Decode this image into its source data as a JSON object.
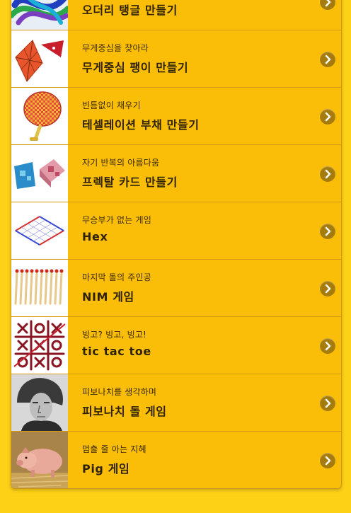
{
  "items": [
    {
      "subtitle": "",
      "title": "오더리 탱글 만들기",
      "thumb": "tangle-thumbnail"
    },
    {
      "subtitle": "무게중심을 찾아라",
      "title": "무게중심 팽이 만들기",
      "thumb": "kite-thumbnail"
    },
    {
      "subtitle": "빈틈없이 채우기",
      "title": "테셀레이션 부채 만들기",
      "thumb": "fan-thumbnail"
    },
    {
      "subtitle": "자기 반복의 아름다움",
      "title": "프렉탈 카드 만들기",
      "thumb": "fractal-card-thumbnail"
    },
    {
      "subtitle": "무승부가 없는 게임",
      "title": "Hex",
      "thumb": "hex-board-thumbnail"
    },
    {
      "subtitle": "마지막 돌의 주인공",
      "title": "NIM 게임",
      "thumb": "matchsticks-thumbnail"
    },
    {
      "subtitle": "빙고? 빙고, 빙고!",
      "title": "tic tac toe",
      "thumb": "tic-tac-toe-thumbnail"
    },
    {
      "subtitle": "피보나치를 생각하며",
      "title": "피보나치 돌 게임",
      "thumb": "fibonacci-portrait-thumbnail"
    },
    {
      "subtitle": "멈출 줄 아는 지혜",
      "title": "Pig 게임",
      "thumb": "pig-thumbnail"
    }
  ],
  "icons": {
    "arrow": "chevron-right-icon"
  },
  "colors": {
    "page_bg": "#fdd116",
    "list_bg": "#fbbe08",
    "arrow_bg": "#a57c0c"
  }
}
